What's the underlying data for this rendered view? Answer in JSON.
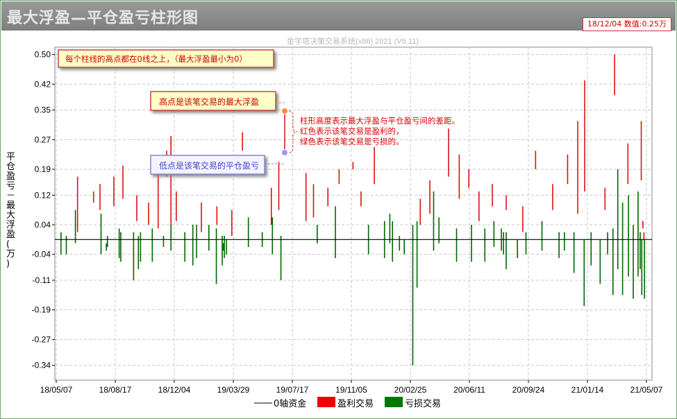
{
  "window": {
    "title": "最大浮盈—平仓盈亏柱形图",
    "readout": "18/12/04 数值:0.25万",
    "watermark": "金字塔决策交易系统(x86) 2021 (V6.11)"
  },
  "colors": {
    "profit": "#dd1111",
    "loss": "#006600",
    "axis": "#000000",
    "grid": "#c8c8c8",
    "note_text": "#dd0000",
    "lo_dot": "#9999ff",
    "hi_dot": "#ff8844"
  },
  "annotations": {
    "note_top": "每个柱线的高点都在0线之上，（最大浮盈最小为0）",
    "note_high": "高点是该笔交易的最大浮盈",
    "note_low": "低点是该笔交易的平仓盈亏",
    "note_explain": [
      "柱形高度表示最大浮盈与平仓盈亏间的差距。",
      "红色表示该笔交易是盈利的，",
      "绿色表示该笔交易是亏损的。"
    ]
  },
  "chart_data": {
    "type": "bar",
    "ylabel": "平仓盈亏－最大浮盈(万)",
    "ylim": [
      -0.38,
      0.52
    ],
    "yticks": [
      "0.50",
      "0.42",
      "0.35",
      "0.27",
      "0.19",
      "0.12",
      "0.04",
      "-0.04",
      "-0.11",
      "-0.19",
      "-0.27",
      "-0.34"
    ],
    "xticks": [
      "18/05/07",
      "18/08/17",
      "18/12/04",
      "19/03/29",
      "19/07/17",
      "19/11/05",
      "20/02/25",
      "20/06/11",
      "20/09/24",
      "21/01/14",
      "21/05/07"
    ],
    "x_range": [
      "2018-05-07",
      "2021-05-14"
    ],
    "grid": true,
    "legend": [
      {
        "name": "0轴资金",
        "style": "line"
      },
      {
        "name": "盈利交易",
        "style": "red"
      },
      {
        "name": "亏损交易",
        "style": "green"
      }
    ],
    "series": [
      {
        "name": "盈利交易",
        "bars": [
          [
            "2018-06-12",
            0.02,
            0.17
          ],
          [
            "2018-07-12",
            0.1,
            0.13
          ],
          [
            "2018-07-24",
            0.08,
            0.15
          ],
          [
            "2018-08-19",
            0.09,
            0.17
          ],
          [
            "2018-09-05",
            0.11,
            0.2
          ],
          [
            "2018-10-01",
            0.05,
            0.12
          ],
          [
            "2018-10-23",
            0.04,
            0.1
          ],
          [
            "2018-11-10",
            0.03,
            0.2
          ],
          [
            "2018-11-26",
            0.17,
            0.24
          ],
          [
            "2018-12-04",
            0.03,
            0.28
          ],
          [
            "2018-12-14",
            0.05,
            0.13
          ],
          [
            "2019-01-30",
            0.02,
            0.1
          ],
          [
            "2019-02-28",
            0.04,
            0.09
          ],
          [
            "2019-03-28",
            0.01,
            0.08
          ],
          [
            "2019-04-17",
            0.24,
            0.29
          ],
          [
            "2019-06-10",
            0.04,
            0.14
          ],
          [
            "2019-06-24",
            0.08,
            0.21
          ],
          [
            "2019-08-14",
            0.05,
            0.18
          ],
          [
            "2019-08-28",
            0.06,
            0.15
          ],
          [
            "2019-09-24",
            0.09,
            0.14
          ],
          [
            "2019-10-15",
            0.15,
            0.19
          ],
          [
            "2019-11-10",
            0.19,
            0.21
          ],
          [
            "2019-11-25",
            0.09,
            0.13
          ],
          [
            "2019-12-20",
            0.15,
            0.25
          ],
          [
            "2020-03-15",
            0.04,
            0.11
          ],
          [
            "2020-04-02",
            0.07,
            0.16
          ],
          [
            "2020-05-07",
            0.17,
            0.3
          ],
          [
            "2020-05-27",
            0.11,
            0.23
          ],
          [
            "2020-06-14",
            0.14,
            0.19
          ],
          [
            "2020-07-03",
            0.05,
            0.13
          ],
          [
            "2020-07-28",
            0.09,
            0.15
          ],
          [
            "2020-08-23",
            0.08,
            0.12
          ],
          [
            "2020-09-23",
            0.02,
            0.09
          ],
          [
            "2020-10-17",
            0.19,
            0.24
          ],
          [
            "2020-11-18",
            0.08,
            0.15
          ],
          [
            "2020-12-16",
            0.15,
            0.23
          ],
          [
            "2021-01-04",
            0.07,
            0.32
          ],
          [
            "2021-01-17",
            0.13,
            0.43
          ],
          [
            "2021-02-24",
            0.08,
            0.14
          ],
          [
            "2021-03-14",
            0.39,
            0.5
          ],
          [
            "2021-04-08",
            0.15,
            0.26
          ],
          [
            "2021-05-03",
            0.16,
            0.32
          ],
          [
            "2021-05-06",
            0.03,
            0.05
          ],
          [
            "2021-05-08",
            0.0,
            0.02
          ]
        ]
      },
      {
        "name": "亏损交易",
        "bars": [
          [
            "2018-05-12",
            -0.04,
            0.02
          ],
          [
            "2018-05-22",
            -0.04,
            0.01
          ],
          [
            "2018-06-08",
            -0.01,
            0.08
          ],
          [
            "2018-07-26",
            -0.04,
            0.07
          ],
          [
            "2018-08-05",
            -0.03,
            -0.01
          ],
          [
            "2018-08-07",
            -0.02,
            0.01
          ],
          [
            "2018-08-29",
            -0.05,
            0.03
          ],
          [
            "2018-09-01",
            -0.06,
            0.02
          ],
          [
            "2018-09-25",
            -0.11,
            0.02
          ],
          [
            "2018-10-04",
            -0.08,
            0.01
          ],
          [
            "2018-10-08",
            -0.06,
            0.02
          ],
          [
            "2018-10-30",
            -0.06,
            0.03
          ],
          [
            "2018-11-20",
            -0.02,
            0.01
          ],
          [
            "2018-12-04",
            -0.03,
            0.04
          ],
          [
            "2018-12-30",
            -0.06,
            0.02
          ],
          [
            "2019-01-14",
            -0.07,
            0.04
          ],
          [
            "2019-01-21",
            -0.05,
            0.04
          ],
          [
            "2019-02-13",
            -0.03,
            0.04
          ],
          [
            "2019-02-27",
            -0.12,
            0.03
          ],
          [
            "2019-03-10",
            -0.07,
            0.01
          ],
          [
            "2019-03-12",
            -0.03,
            -0.01
          ],
          [
            "2019-03-14",
            -0.05,
            0.01
          ],
          [
            "2019-03-18",
            -0.04,
            0.0
          ],
          [
            "2019-04-28",
            -0.02,
            0.06
          ],
          [
            "2019-05-24",
            -0.02,
            0.02
          ],
          [
            "2019-06-12",
            -0.04,
            0.06
          ],
          [
            "2019-06-28",
            -0.11,
            0.01
          ],
          [
            "2019-09-04",
            -0.01,
            0.04
          ],
          [
            "2019-10-08",
            -0.05,
            0.09
          ],
          [
            "2019-12-09",
            -0.04,
            0.04
          ],
          [
            "2020-01-08",
            -0.05,
            0.05
          ],
          [
            "2020-01-18",
            -0.01,
            0.07
          ],
          [
            "2020-01-23",
            -0.06,
            0.05
          ],
          [
            "2020-02-05",
            -0.03,
            0.01
          ],
          [
            "2020-02-14",
            -0.04,
            0.0
          ],
          [
            "2020-03-01",
            -0.34,
            0.04
          ],
          [
            "2020-03-09",
            -0.13,
            0.05
          ],
          [
            "2020-04-09",
            -0.03,
            0.13
          ],
          [
            "2020-04-19",
            -0.01,
            0.06
          ],
          [
            "2020-05-22",
            -0.06,
            0.03
          ],
          [
            "2020-06-19",
            -0.06,
            0.04
          ],
          [
            "2020-07-14",
            -0.06,
            0.03
          ],
          [
            "2020-07-31",
            -0.02,
            0.05
          ],
          [
            "2020-08-14",
            -0.03,
            0.03
          ],
          [
            "2020-08-18",
            -0.04,
            0.02
          ],
          [
            "2020-08-23",
            -0.08,
            0.02
          ],
          [
            "2020-09-13",
            -0.05,
            0.0
          ],
          [
            "2020-09-29",
            -0.04,
            0.02
          ],
          [
            "2020-10-29",
            -0.03,
            0.05
          ],
          [
            "2020-11-30",
            -0.05,
            0.02
          ],
          [
            "2020-12-10",
            -0.03,
            0.02
          ],
          [
            "2020-12-28",
            -0.09,
            0.02
          ],
          [
            "2021-01-16",
            -0.18,
            0.0
          ],
          [
            "2021-01-29",
            -0.07,
            0.02
          ],
          [
            "2021-02-15",
            -0.12,
            0.0
          ],
          [
            "2021-03-01",
            -0.04,
            0.02
          ],
          [
            "2021-03-11",
            -0.15,
            0.03
          ],
          [
            "2021-03-20",
            -0.08,
            0.19
          ],
          [
            "2021-03-29",
            -0.15,
            0.1
          ],
          [
            "2021-04-09",
            -0.1,
            0.12
          ],
          [
            "2021-04-18",
            -0.16,
            0.04
          ],
          [
            "2021-04-27",
            -0.1,
            0.13
          ],
          [
            "2021-05-01",
            -0.08,
            0.02
          ],
          [
            "2021-05-04",
            -0.15,
            0.0
          ],
          [
            "2021-05-09",
            -0.16,
            0.0
          ]
        ]
      }
    ]
  }
}
